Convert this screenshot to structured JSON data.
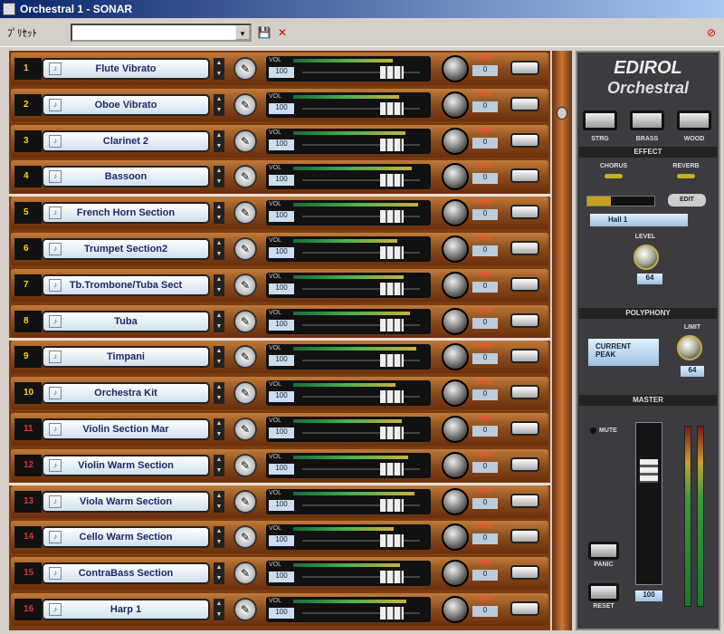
{
  "window": {
    "title": "Orchestral 1 - SONAR"
  },
  "toolbar": {
    "preset_label": "ﾌﾟﾘｾｯﾄ",
    "preset_value": "",
    "dropdown": "▾",
    "save_icon": "💾",
    "delete_icon": "✕",
    "close_icon": "⊘"
  },
  "parts": [
    {
      "num": "1",
      "name": "Flute Vibrato"
    },
    {
      "num": "2",
      "name": "Oboe Vibrato"
    },
    {
      "num": "3",
      "name": "Clarinet 2"
    },
    {
      "num": "4",
      "name": "Bassoon"
    },
    {
      "num": "5",
      "name": "French Horn Section"
    },
    {
      "num": "6",
      "name": "Trumpet Section2"
    },
    {
      "num": "7",
      "name": "Tb.Trombone/Tuba Sect"
    },
    {
      "num": "8",
      "name": "Tuba"
    },
    {
      "num": "9",
      "name": "Timpani"
    },
    {
      "num": "10",
      "name": "Orchestra Kit"
    },
    {
      "num": "11",
      "name": "Violin Section Mar"
    },
    {
      "num": "12",
      "name": "Violin Warm Section"
    },
    {
      "num": "13",
      "name": "Viola Warm Section"
    },
    {
      "num": "14",
      "name": "Cello Warm Section"
    },
    {
      "num": "15",
      "name": "ContraBass Section"
    },
    {
      "num": "16",
      "name": "Harp 1"
    }
  ],
  "row_labels": {
    "vol": "VOL",
    "vol_value": "100",
    "pan": "PAN",
    "pan_value": "0"
  },
  "panel": {
    "brand": "EDIROL",
    "product": "Orchestral",
    "mode_buttons": [
      "STRG",
      "BRASS",
      "WOOD"
    ],
    "effect": {
      "title": "EFFECT",
      "chorus": "CHORUS",
      "reverb": "REVERB",
      "type": "Hall 1",
      "level_label": "LEVEL",
      "level_value": "64",
      "edit": "EDIT"
    },
    "poly": {
      "title": "POLYPHONY",
      "line1": "CURRENT",
      "line2": "PEAK",
      "limit_label": "LIMIT",
      "limit_value": "64"
    },
    "mixer": {
      "title": "MASTER",
      "mute": "MUTE",
      "panic": "PANIC",
      "reset": "RESET",
      "volume": "100"
    }
  }
}
